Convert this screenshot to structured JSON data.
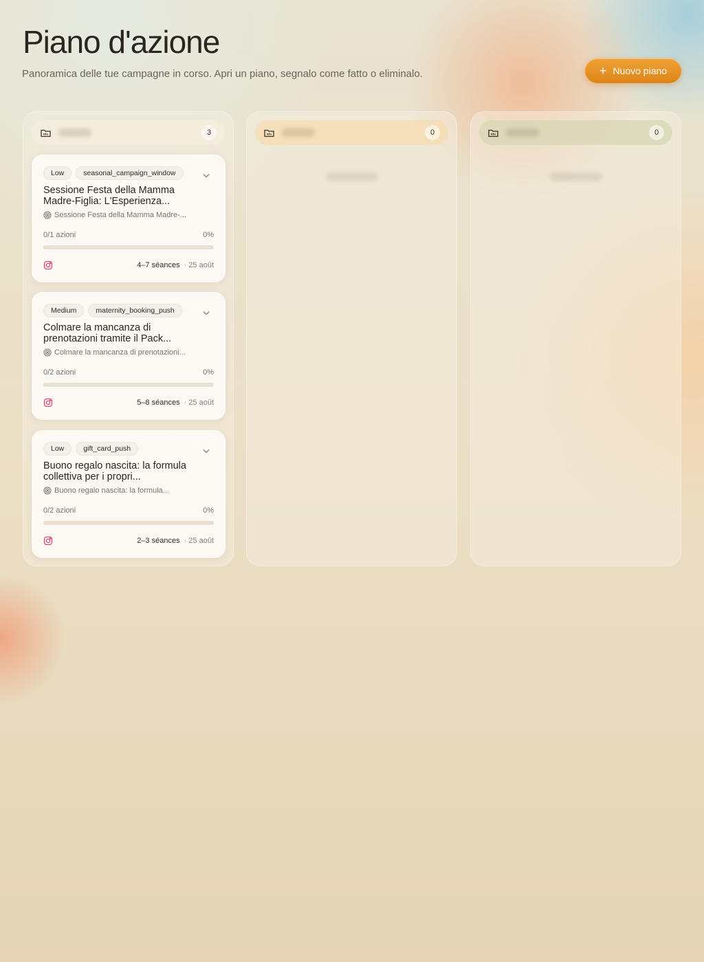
{
  "page": {
    "title": "Piano d'azione",
    "subtitle": "Panoramica delle tue campagne in corso. Apri un piano, segnalo come fatto o eliminalo."
  },
  "new_plan_button": {
    "label": "Nuovo piano",
    "icon": "plus-icon"
  },
  "colors": {
    "accent": "#E8931F",
    "instagram": "#E0457A"
  },
  "columns": [
    {
      "count": "3",
      "icon": "folder-icon"
    },
    {
      "count": "0",
      "icon": "folder-icon"
    },
    {
      "count": "0",
      "icon": "folder-icon"
    }
  ],
  "cards": [
    {
      "priority": "Low",
      "tag": "seasonal_campaign_window",
      "title": "Sessione Festa della Mamma Madre-Figlia: L'Esperienza...",
      "subtitle": "Sessione Festa della Mamma Madre-...",
      "actions": "0/1 azioni",
      "percent": "0%",
      "progress": 0,
      "sessions": "4–7 séances",
      "date": "· 25 août",
      "channel_icon": "instagram-icon"
    },
    {
      "priority": "Medium",
      "tag": "maternity_booking_push",
      "title": "Colmare la mancanza di prenotazioni tramite il Pack...",
      "subtitle": "Colmare la mancanza di prenotazioni...",
      "actions": "0/2 azioni",
      "percent": "0%",
      "progress": 0,
      "sessions": "5–8 séances",
      "date": "· 25 août",
      "channel_icon": "instagram-icon"
    },
    {
      "priority": "Low",
      "tag": "gift_card_push",
      "title": "Buono regalo nascita: la formula collettiva per i propri...",
      "subtitle": "Buono regalo nascita: la formula...",
      "actions": "0/2 azioni",
      "percent": "0%",
      "progress": 0,
      "sessions": "2–3 séances",
      "date": "· 25 août",
      "channel_icon": "instagram-icon"
    }
  ]
}
